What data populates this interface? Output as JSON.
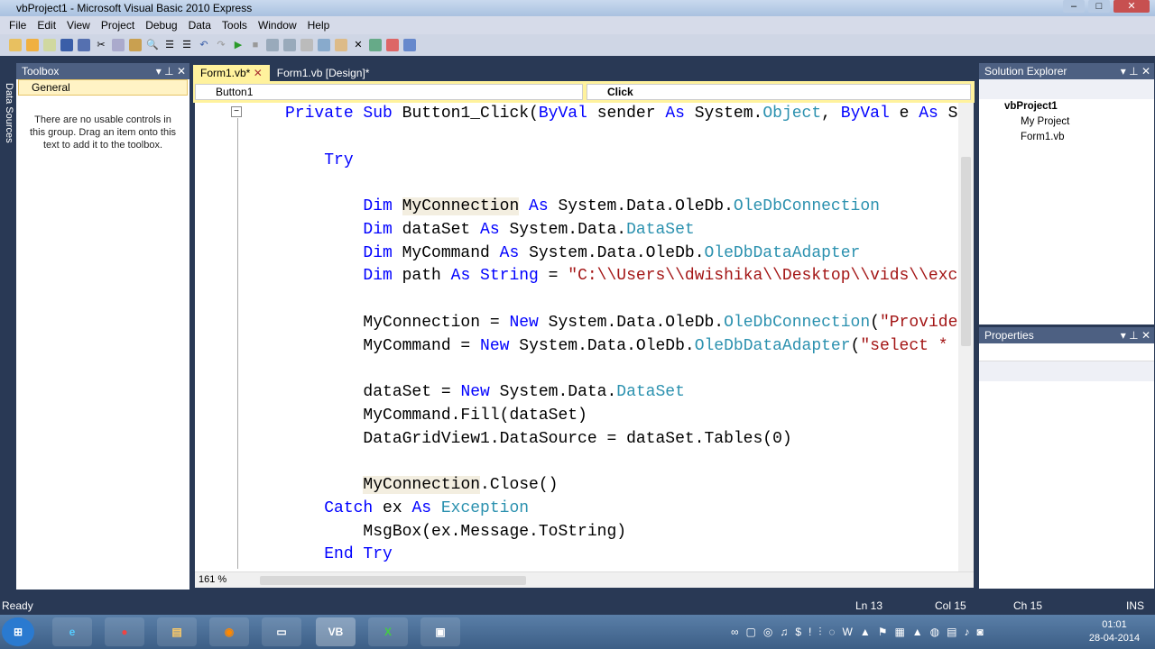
{
  "window": {
    "title": "vbProject1 - Microsoft Visual Basic 2010 Express"
  },
  "menu": [
    "File",
    "Edit",
    "View",
    "Project",
    "Debug",
    "Data",
    "Tools",
    "Window",
    "Help"
  ],
  "side_strip": "Data Sources",
  "toolbox": {
    "title": "Toolbox",
    "group": "General",
    "empty_text": "There are no usable controls in this group. Drag an item onto this text to add it to the toolbox."
  },
  "tabs": [
    {
      "label": "Form1.vb*",
      "active": true
    },
    {
      "label": "Form1.vb [Design]*",
      "active": false
    }
  ],
  "nav": {
    "object": "Button1",
    "member": "Click"
  },
  "editor": {
    "zoom": "161 %",
    "lines": [
      [
        [
          "    Private ",
          "kw"
        ],
        [
          "Sub ",
          "kw"
        ],
        [
          "Button1_Click(",
          "tx"
        ],
        [
          "ByVal ",
          "kw"
        ],
        [
          "sender ",
          "tx"
        ],
        [
          "As ",
          "kw"
        ],
        [
          "System.",
          "tx"
        ],
        [
          "Object",
          "ty"
        ],
        [
          ", ",
          "tx"
        ],
        [
          "ByVal ",
          "kw"
        ],
        [
          "e ",
          "tx"
        ],
        [
          "As ",
          "kw"
        ],
        [
          "S",
          "tx"
        ]
      ],
      [],
      [
        [
          "        Try",
          "kw"
        ]
      ],
      [],
      [
        [
          "            Dim ",
          "kw"
        ],
        [
          "MyConnection",
          "hl"
        ],
        [
          " As ",
          "kw"
        ],
        [
          "System.Data.OleDb.",
          "tx"
        ],
        [
          "OleDbConnection",
          "ty"
        ]
      ],
      [
        [
          "            Dim ",
          "kw"
        ],
        [
          "dataSet ",
          "tx"
        ],
        [
          "As ",
          "kw"
        ],
        [
          "System.Data.",
          "tx"
        ],
        [
          "DataSet",
          "ty"
        ]
      ],
      [
        [
          "            Dim ",
          "kw"
        ],
        [
          "MyCommand ",
          "tx"
        ],
        [
          "As ",
          "kw"
        ],
        [
          "System.Data.OleDb.",
          "tx"
        ],
        [
          "OleDbDataAdapter",
          "ty"
        ]
      ],
      [
        [
          "            Dim ",
          "kw"
        ],
        [
          "path ",
          "tx"
        ],
        [
          "As ",
          "kw"
        ],
        [
          "String",
          "kw"
        ],
        [
          " = ",
          "tx"
        ],
        [
          "\"C:\\\\Users\\\\dwishika\\\\Desktop\\\\vids\\\\exc",
          "st"
        ]
      ],
      [],
      [
        [
          "            MyConnection",
          "tx"
        ],
        [
          " = ",
          "tx"
        ],
        [
          "New ",
          "kw"
        ],
        [
          "System.Data.OleDb.",
          "tx"
        ],
        [
          "OleDbConnection",
          "ty"
        ],
        [
          "(",
          "tx"
        ],
        [
          "\"Provide",
          "st"
        ]
      ],
      [
        [
          "            MyCommand = ",
          "tx"
        ],
        [
          "New ",
          "kw"
        ],
        [
          "System.Data.OleDb.",
          "tx"
        ],
        [
          "OleDbDataAdapter",
          "ty"
        ],
        [
          "(",
          "tx"
        ],
        [
          "\"select * ",
          "st"
        ]
      ],
      [],
      [
        [
          "            dataSet = ",
          "tx"
        ],
        [
          "New ",
          "kw"
        ],
        [
          "System.Data.",
          "tx"
        ],
        [
          "DataSet",
          "ty"
        ]
      ],
      [
        [
          "            MyCommand.Fill(dataSet)",
          "tx"
        ]
      ],
      [
        [
          "            DataGridView1.DataSource = dataSet.Tables(0)",
          "tx"
        ]
      ],
      [],
      [
        [
          "            ",
          "tx"
        ],
        [
          "MyConnection",
          "hl"
        ],
        [
          ".Close()",
          "tx"
        ]
      ],
      [
        [
          "        Catch ",
          "kw"
        ],
        [
          "ex ",
          "tx"
        ],
        [
          "As ",
          "kw"
        ],
        [
          "Exception",
          "ty"
        ]
      ],
      [
        [
          "            MsgBox(ex.Message.ToString)",
          "tx"
        ]
      ],
      [
        [
          "        End Try",
          "kw"
        ]
      ]
    ]
  },
  "solution_explorer": {
    "title": "Solution Explorer",
    "items": [
      "vbProject1",
      "My Project",
      "Form1.vb"
    ]
  },
  "properties": {
    "title": "Properties"
  },
  "status": {
    "ready": "Ready",
    "ln": "Ln 13",
    "col": "Col 15",
    "ch": "Ch 15",
    "mode": "INS"
  },
  "taskbar": {
    "time": "01:01",
    "date": "28-04-2014"
  }
}
